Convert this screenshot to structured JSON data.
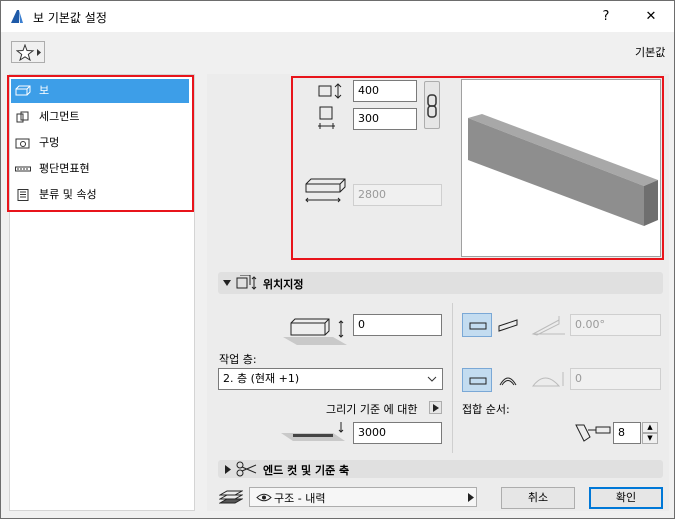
{
  "window": {
    "title": "보 기본값 설정",
    "help": "?",
    "close": "✕"
  },
  "header": {
    "defaults_label": "기본값"
  },
  "sidebar": {
    "items": [
      {
        "label": "보",
        "selected": true
      },
      {
        "label": "세그먼트"
      },
      {
        "label": "구멍"
      },
      {
        "label": "평단면표현"
      },
      {
        "label": "분류 및 속성"
      }
    ]
  },
  "geometry": {
    "height": "400",
    "width": "300",
    "length": "2800"
  },
  "positioning": {
    "section_title": "위치지정",
    "offset": "0",
    "story_label": "작업 층:",
    "story_value": "2. 층 (현재 +1)",
    "reference_label": "그리기 기준 에 대한",
    "reference_value": "3000",
    "slope_angle": "0.00°",
    "curve_value": "0",
    "priority_label": "접합 순서:",
    "priority_value": "8"
  },
  "end_cuts": {
    "section_title": "엔드 컷 및 기준 축"
  },
  "footer": {
    "layer": "구조 - 내력",
    "cancel_label": "취소",
    "ok_label": "확인"
  }
}
